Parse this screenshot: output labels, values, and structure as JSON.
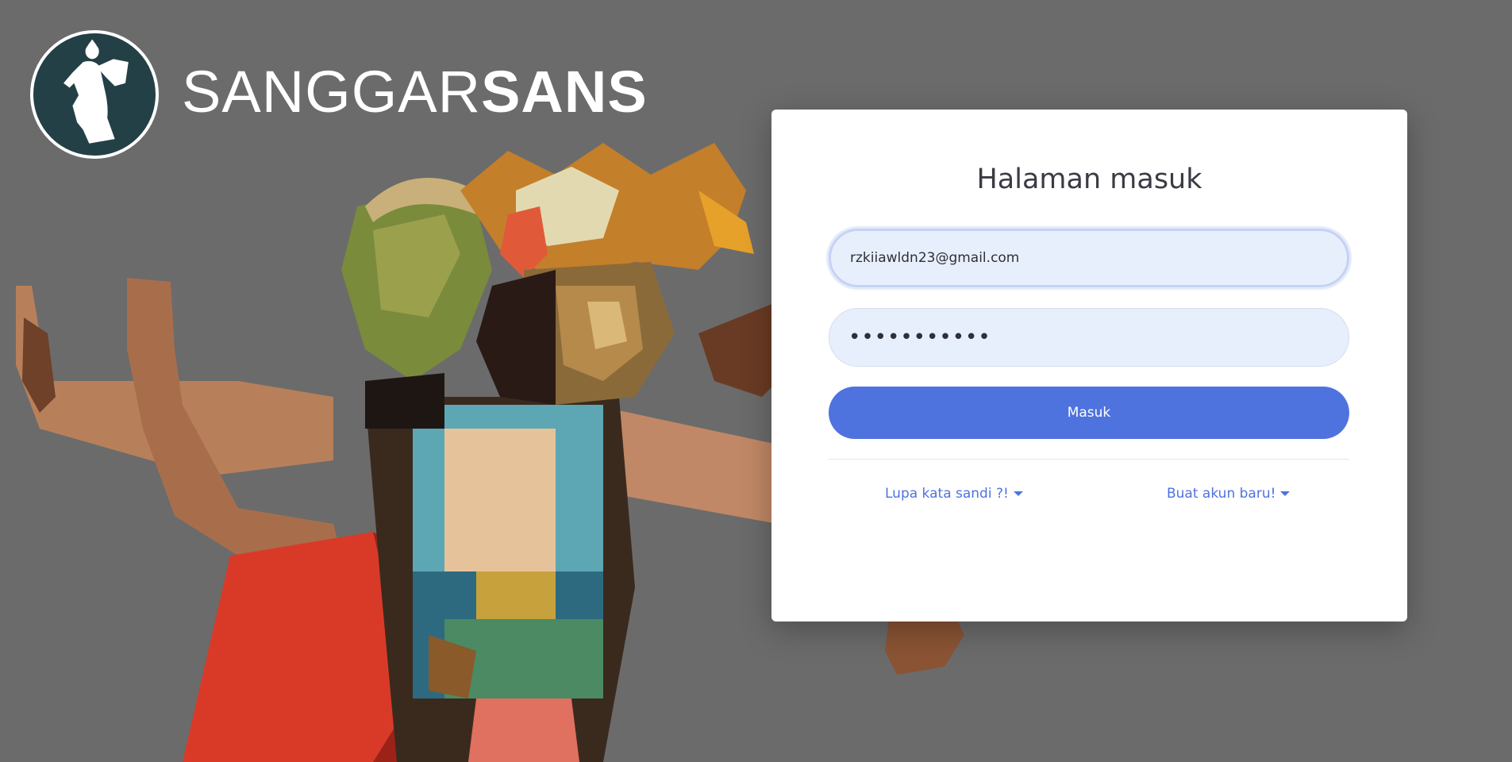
{
  "brand": {
    "name_light": "SANGGAR",
    "name_bold": "SANS"
  },
  "login": {
    "title": "Halaman masuk",
    "email_value": "rzkiiawldn23@gmail.com",
    "password_value": "•••••••••••",
    "submit_label": "Masuk",
    "forgot_label": "Lupa kata sandi ?!",
    "register_label": "Buat akun baru!"
  },
  "colors": {
    "background": "#6b6b6b",
    "card": "#ffffff",
    "primary": "#4e73df",
    "input_bg": "#e8effc",
    "logo_bg": "#234046"
  },
  "icons": {
    "logo": "dancer-silhouette-icon",
    "dropdown": "caret-down-icon"
  }
}
